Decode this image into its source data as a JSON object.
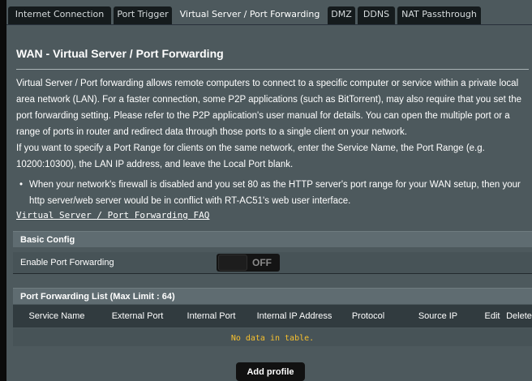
{
  "tabs": [
    {
      "label": "Internet Connection",
      "active": false
    },
    {
      "label": "Port Trigger",
      "active": false
    },
    {
      "label": "Virtual Server / Port Forwarding",
      "active": true
    },
    {
      "label": "DMZ",
      "active": false
    },
    {
      "label": "DDNS",
      "active": false
    },
    {
      "label": "NAT Passthrough",
      "active": false
    }
  ],
  "page": {
    "title": "WAN - Virtual Server / Port Forwarding",
    "description": "Virtual Server / Port forwarding allows remote computers to connect to a specific computer or service within a private local area network (LAN). For a faster connection, some P2P applications (such as BitTorrent), may also require that you set the port forwarding setting. Please refer to the P2P application's user manual for details. You can open the multiple port or a range of ports in router and redirect data through those ports to a single client on your network.",
    "description2": "If you want to specify a Port Range for clients on the same network, enter the Service Name, the Port Range (e.g. 10200:10300), the LAN IP address, and leave the Local Port blank.",
    "bullet": "When your network's firewall is disabled and you set 80 as the HTTP server's port range for your WAN setup, then your http server/web server would be in conflict with RT-AC51's web user interface.",
    "faq_link": "Virtual Server / Port Forwarding FAQ"
  },
  "basic_config": {
    "header": "Basic Config",
    "enable_label": "Enable Port Forwarding",
    "toggle_state": "OFF"
  },
  "forwarding_list": {
    "header": "Port Forwarding List (Max Limit : 64)",
    "columns": [
      "Service Name",
      "External Port",
      "Internal Port",
      "Internal IP Address",
      "Protocol",
      "Source IP",
      "Edit",
      "Delete"
    ],
    "empty_message": "No data in table."
  },
  "actions": {
    "add_profile": "Add profile"
  },
  "colors": {
    "panel": "#4d595d",
    "tab_inactive": "#151b1d",
    "section_header": "#5f6c71",
    "table_header": "#313b3f",
    "empty_text": "#f7c02e"
  }
}
